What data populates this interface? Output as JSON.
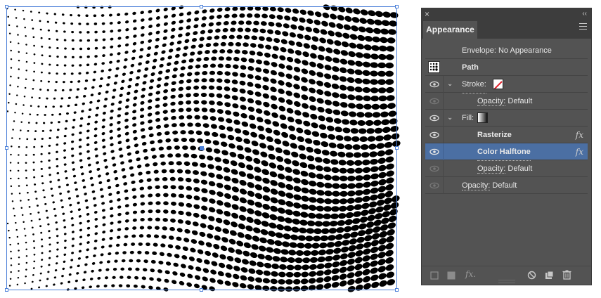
{
  "panel": {
    "close_glyph": "×",
    "collapse_glyph": "‹‹",
    "tab_label": "Appearance",
    "menu_icon": "panel-menu-icon",
    "rows": {
      "envelope": "Envelope: No Appearance",
      "path": "Path",
      "stroke_label": "Stroke:",
      "stroke_opacity_label": "Opacity:",
      "stroke_opacity_value": "Default",
      "fill_label": "Fill:",
      "rasterize": "Rasterize",
      "color_halftone": "Color Halftone",
      "fill_opacity_label": "Opacity:",
      "fill_opacity_value": "Default",
      "opacity_label": "Opacity:",
      "opacity_value": "Default",
      "fx_glyph": "fx"
    },
    "bottom_icons": [
      "add-new-stroke-icon",
      "add-new-fill-icon",
      "add-new-effect-icon",
      "clear-appearance-icon",
      "duplicate-item-icon",
      "delete-item-icon"
    ],
    "fx_bottom": "fx."
  },
  "colors": {
    "panel_bg": "#535353",
    "panel_header": "#3d3d3d",
    "selection": "#4b6fa3",
    "bbox": "#4a7fd8",
    "dots": "#000000"
  }
}
